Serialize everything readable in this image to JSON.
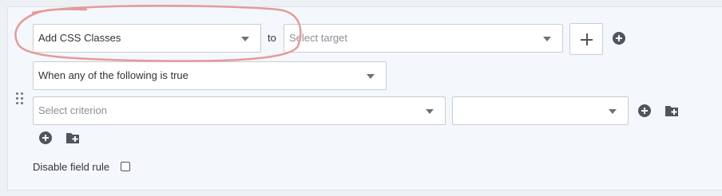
{
  "rule": {
    "action_select": {
      "value": "Add CSS Classes"
    },
    "connector_label": "to",
    "target_select": {
      "placeholder": "Select target"
    },
    "add_button_icon": "plus-icon",
    "add_rule_icon": "plus-circle-icon"
  },
  "conditions": {
    "logic_select": {
      "value": "When any of the following is true"
    },
    "criterion_select": {
      "placeholder": "Select criterion"
    },
    "value_select": {
      "value": ""
    },
    "add_condition_icon": "plus-circle-icon",
    "add_group_icon": "folder-plus-icon"
  },
  "footer": {
    "disable_label": "Disable field rule",
    "disable_checked": false
  },
  "annotation": {
    "color": "#e59a9a"
  }
}
